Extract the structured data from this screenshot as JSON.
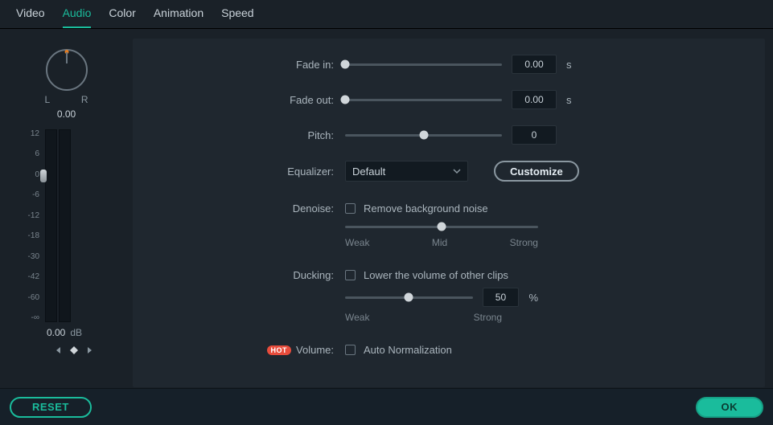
{
  "tabs": {
    "video": "Video",
    "audio": "Audio",
    "color": "Color",
    "animation": "Animation",
    "speed": "Speed",
    "active": "audio"
  },
  "panel": {
    "balance": {
      "L": "L",
      "R": "R",
      "value": "0.00"
    },
    "meter": {
      "ticks": [
        "12",
        "6",
        "0",
        "-6",
        "-12",
        "-18",
        "-30",
        "-42",
        "-60",
        "-∞"
      ],
      "value": "0.00",
      "unit": "dB"
    }
  },
  "form": {
    "fade_in": {
      "label": "Fade in:",
      "value": "0.00",
      "unit": "s",
      "pos": 0
    },
    "fade_out": {
      "label": "Fade out:",
      "value": "0.00",
      "unit": "s",
      "pos": 0
    },
    "pitch": {
      "label": "Pitch:",
      "value": "0",
      "pos": 50
    },
    "equalizer": {
      "label": "Equalizer:",
      "selected": "Default",
      "customize": "Customize"
    },
    "denoise": {
      "label": "Denoise:",
      "checkbox_label": "Remove background noise",
      "scale": {
        "weak": "Weak",
        "mid": "Mid",
        "strong": "Strong"
      },
      "pos": 50
    },
    "ducking": {
      "label": "Ducking:",
      "checkbox_label": "Lower the volume of other clips",
      "scale": {
        "weak": "Weak",
        "strong": "Strong"
      },
      "value": "50",
      "unit": "%",
      "pos": 50
    },
    "volume": {
      "label": "Volume:",
      "badge": "HOT",
      "checkbox_label": "Auto Normalization"
    }
  },
  "footer": {
    "reset": "RESET",
    "ok": "OK"
  }
}
